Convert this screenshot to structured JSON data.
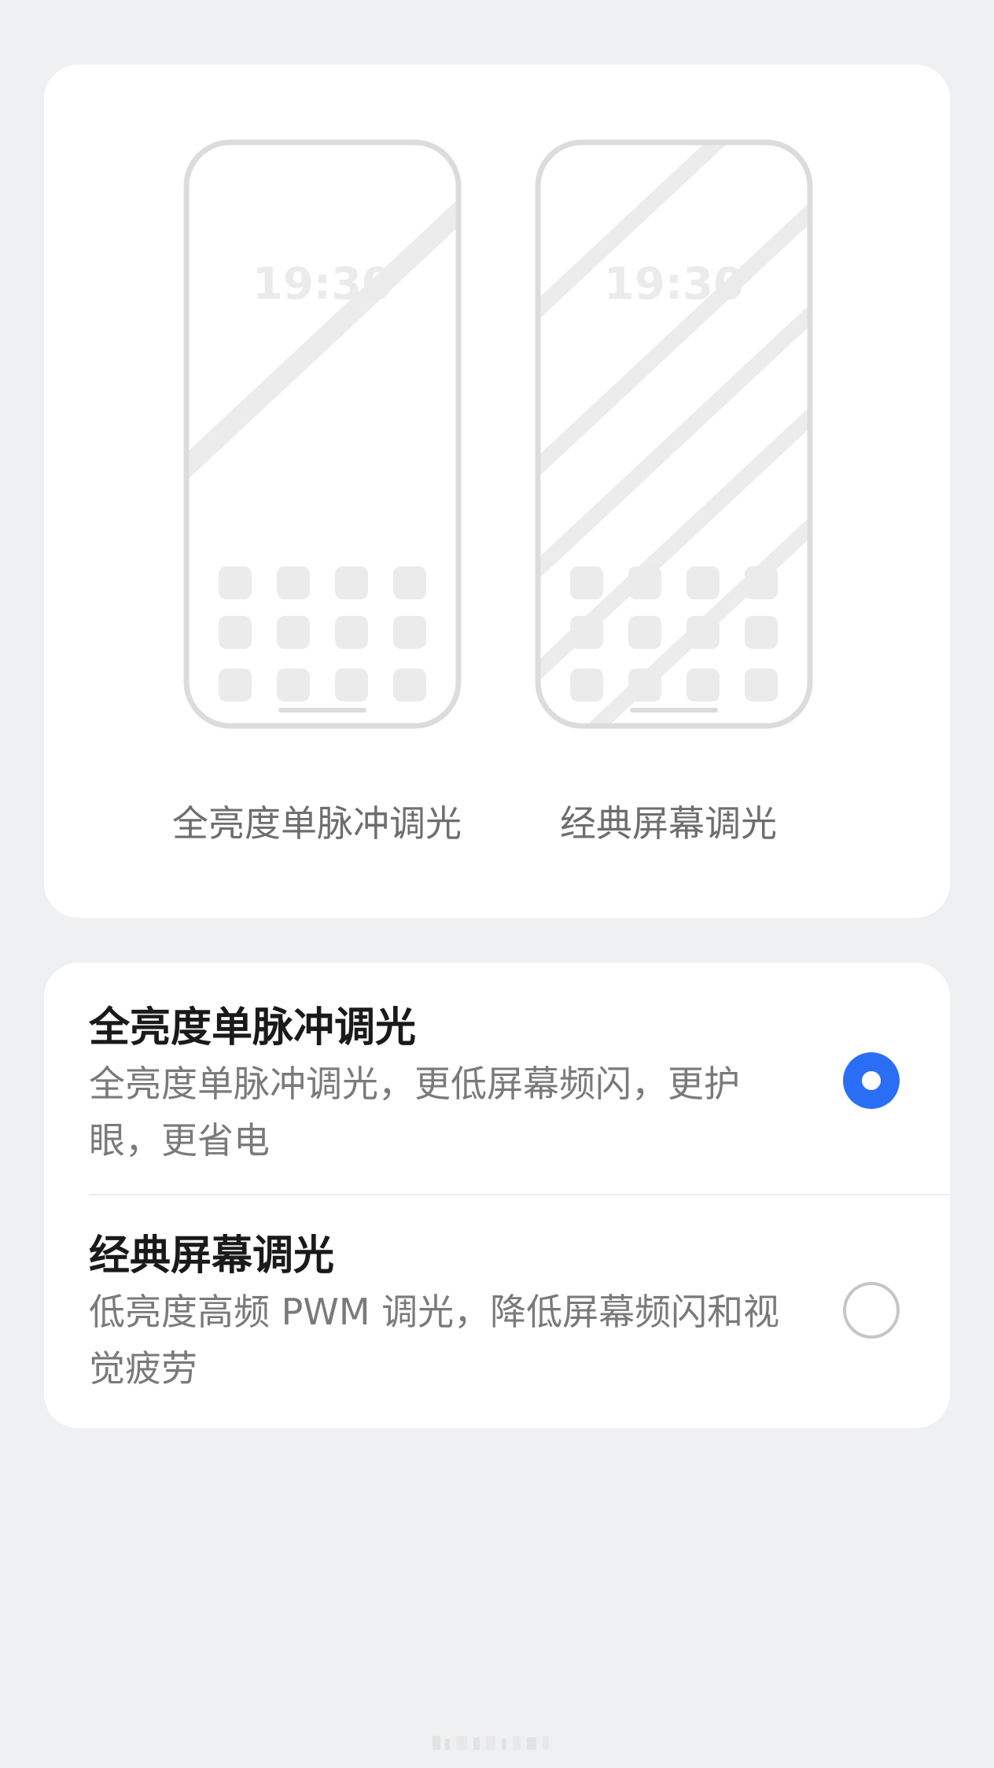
{
  "preview": {
    "clock_time": "19:30",
    "left_label": "全亮度单脉冲调光",
    "right_label": "经典屏幕调光"
  },
  "options": [
    {
      "title": "全亮度单脉冲调光",
      "description": "全亮度单脉冲调光，更低屏幕频闪，更护眼，更省电",
      "selected": true
    },
    {
      "title": "经典屏幕调光",
      "description": "低亮度高频 PWM 调光，降低屏幕频闪和视觉疲劳",
      "selected": false
    }
  ],
  "colors": {
    "background": "#eff0f2",
    "card": "#ffffff",
    "accent": "#2b6ef6",
    "title_text": "#1a1a1a",
    "desc_text": "#7a7a7a"
  }
}
